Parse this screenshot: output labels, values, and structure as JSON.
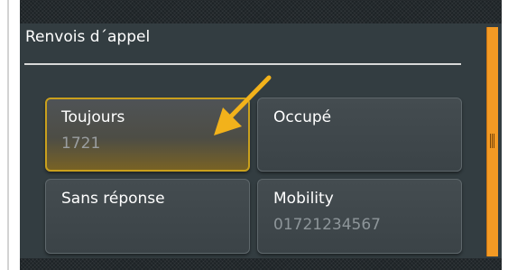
{
  "panel": {
    "title": "Renvois d´appel"
  },
  "forwarding_options": [
    {
      "label": "Toujours",
      "number": "1721",
      "active": true
    },
    {
      "label": "Occupé",
      "number": "",
      "active": false
    },
    {
      "label": "Sans réponse",
      "number": "",
      "active": false
    },
    {
      "label": "Mobility",
      "number": "01721234567",
      "active": false
    }
  ],
  "colors": {
    "panel_background": "#333d41",
    "active_border": "#c9a01d",
    "scrollbar": "#f39a24",
    "annotation_arrow": "#f2b21b"
  },
  "icons": {
    "annotation": "arrow-pointer-icon",
    "scroll_grip": "grip-lines-icon"
  }
}
